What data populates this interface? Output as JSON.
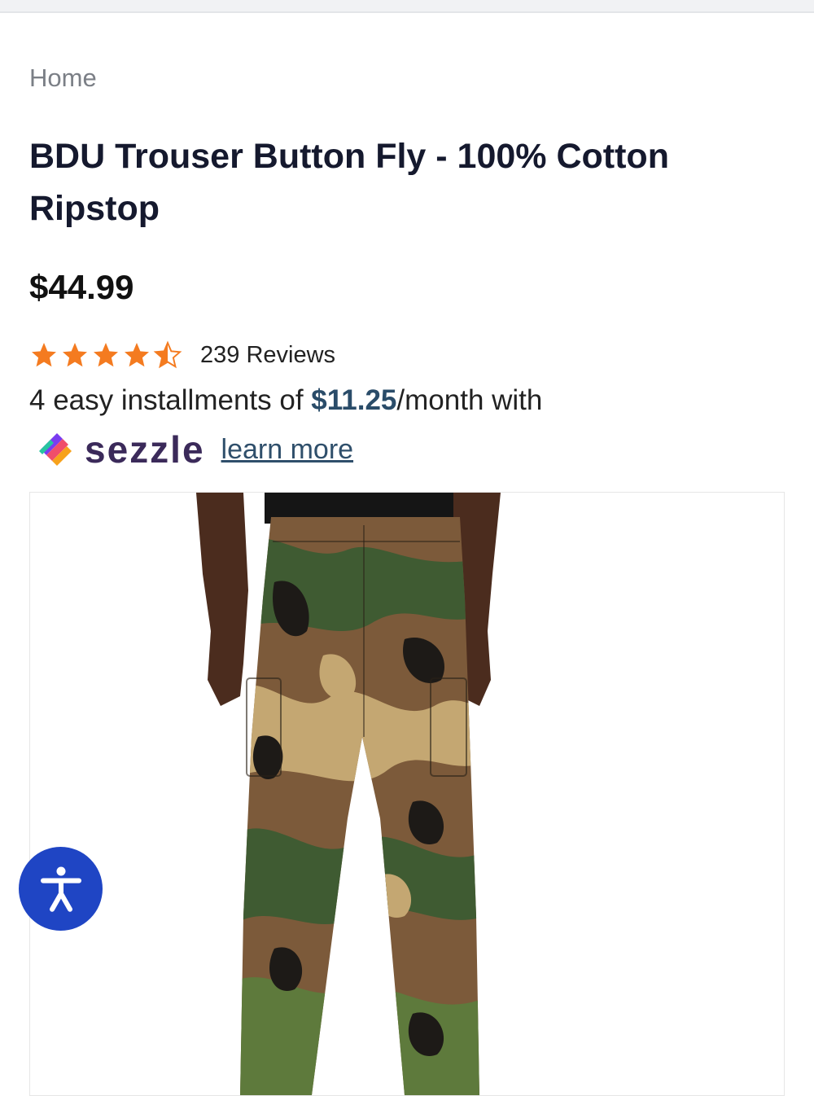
{
  "breadcrumb": {
    "home": "Home"
  },
  "product": {
    "title": "BDU Trouser Button Fly - 100% Cotton Ripstop",
    "price": "$44.99",
    "rating": 4.5,
    "rating_max": 5,
    "reviews": "239 Reviews",
    "image_icon": "camouflage-cargo-pants-photo"
  },
  "installments": {
    "prefix": "4 easy installments of ",
    "amount": "$11.25",
    "suffix": "/month with"
  },
  "sezzle": {
    "brand": "sezzle",
    "learn_more": "learn more"
  },
  "accessibility": {
    "icon": "accessibility-person-icon"
  },
  "colors": {
    "star": "#f47b20",
    "accent": "#2a4c69",
    "a11y": "#1f45c4",
    "sezzle": "#3b2a5a"
  }
}
